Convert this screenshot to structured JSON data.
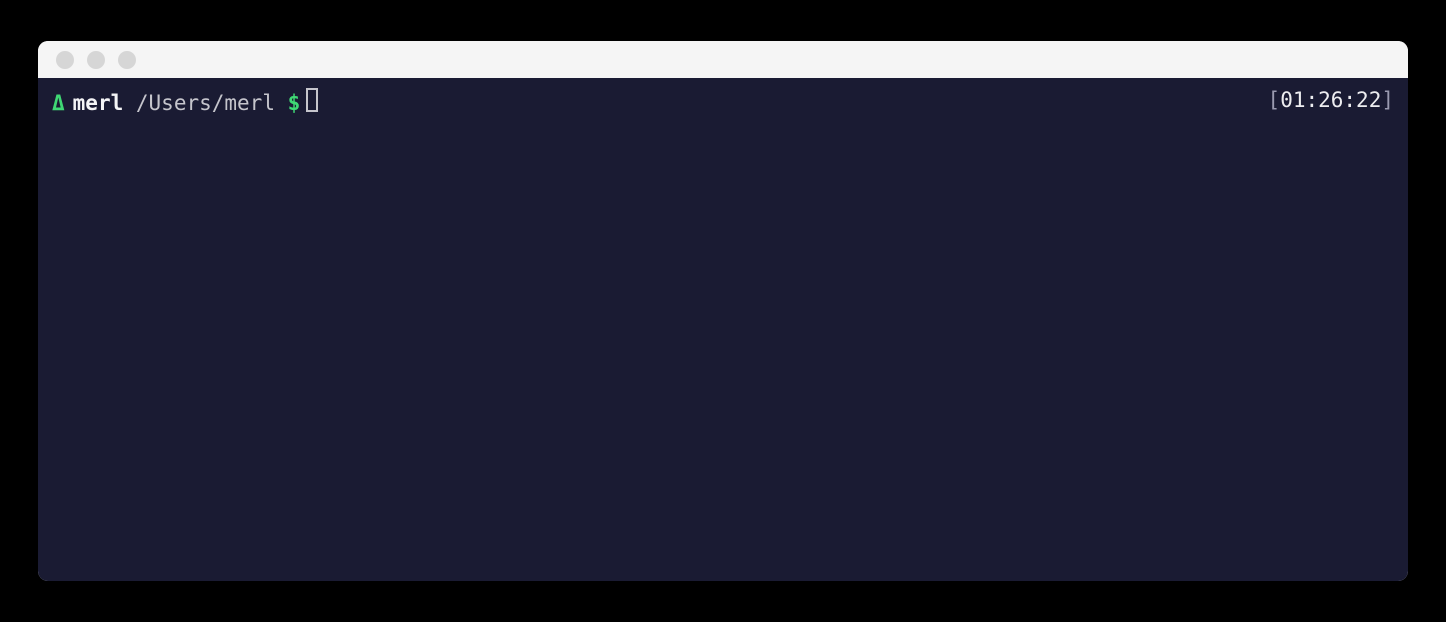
{
  "prompt": {
    "delta": "Δ",
    "hostname": "merl",
    "path": "/Users/merl",
    "symbol": "$"
  },
  "clock": {
    "open_bracket": "[",
    "time": "01:26:22",
    "close_bracket": "]"
  },
  "colors": {
    "background": "#1a1b33",
    "accent_green": "#3fd874",
    "text_primary": "#e8e8ea",
    "text_muted": "#c5c5cc"
  }
}
